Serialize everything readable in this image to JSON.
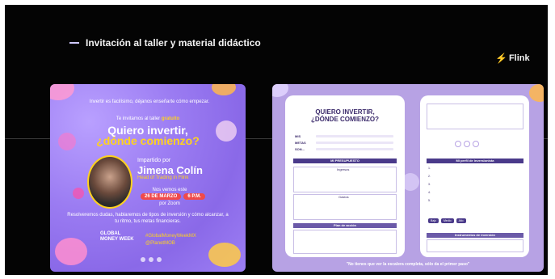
{
  "slide": {
    "title": "Invitación al taller y material didáctico",
    "brand": "Flink"
  },
  "invite": {
    "intro": "Invertir es facilísimo, déjanos enseñarte cómo empezar.",
    "invite_prefix": "Te invitamos al taller",
    "invite_highlight": "gratuito",
    "headline_1": "Quiero invertir,",
    "headline_2": "¿dónde comienzo?",
    "by": "Impartido por",
    "speaker": "Jimena Colín",
    "role": "Head of Trading in Flink",
    "see_you": "Nos vemos este",
    "date": "26 DE MARZO",
    "time": "6 P.M.",
    "via": "por Zoom",
    "resolve": "Resolveremos dudas, hablaremos de tipos de inversión y cómo alcanzar, a tu ritmo, tus metas financieras.",
    "event_logo": "GLOBAL MONEY WEEK",
    "hashtag_1": "#GlobalMoneyWeekMX",
    "hashtag_2": "@PlanetMOB"
  },
  "workbook": {
    "title": "QUIERO INVERTIR, ¿DÓNDE COMIENZO?",
    "field_1": "MIS",
    "field_2": "METAS",
    "field_3": "SON...",
    "budget_header": "MI PRESUPUESTO",
    "ingresos": "Ingresos",
    "gastos": "Gastos",
    "plan_header": "Plan de acción",
    "invest_header": "Mi perfil de inversionista",
    "option_1": "Bajo",
    "option_2": "Medio",
    "option_3": "Alto",
    "instruments": "Instrumentos de inversión",
    "quote": "\"No tienes que ver la escalera completa, sólo da el primer paso\""
  }
}
